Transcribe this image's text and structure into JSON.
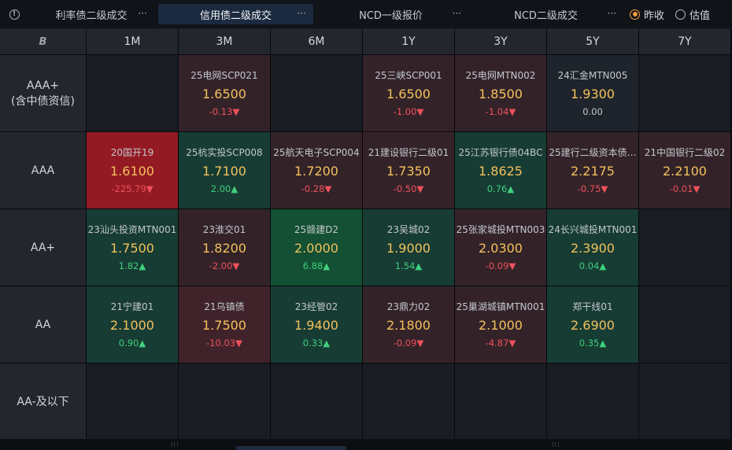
{
  "tabs": [
    {
      "label": "利率债二级成交",
      "more": "···"
    },
    {
      "label": "信用债二级成交",
      "more": "···",
      "active": true
    },
    {
      "label": "NCD一级报价",
      "more": "···"
    },
    {
      "label": "NCD二级成交",
      "more": "···"
    }
  ],
  "radios": [
    {
      "label": "昨收",
      "selected": true
    },
    {
      "label": "估值",
      "selected": false
    }
  ],
  "table": {
    "corner_icon": "B",
    "columns": [
      "1M",
      "3M",
      "6M",
      "1Y",
      "3Y",
      "5Y",
      "7Y"
    ],
    "rows": [
      {
        "label_line1": "AAA+",
        "label_line2": "(含中债资信)",
        "cells": [
          null,
          {
            "name": "25电网SCP021",
            "yield": "1.6500",
            "change": "-0.13",
            "arrow": "▼",
            "dir": "down",
            "tone": "down-light"
          },
          null,
          {
            "name": "25三峡SCP001",
            "yield": "1.6500",
            "change": "-1.00",
            "arrow": "▼",
            "dir": "down",
            "tone": "down-light"
          },
          {
            "name": "25电网MTN002",
            "yield": "1.8500",
            "change": "-1.04",
            "arrow": "▼",
            "dir": "down",
            "tone": "down-light"
          },
          {
            "name": "24汇金MTN005",
            "yield": "1.9300",
            "change": "0.00",
            "arrow": "",
            "dir": "flat",
            "tone": "neutral"
          },
          null
        ]
      },
      {
        "label_line1": "AAA",
        "label_line2": "",
        "cells": [
          {
            "name": "20国开19",
            "yield": "1.6100",
            "change": "-225.79",
            "arrow": "▼",
            "dir": "down",
            "tone": "down-strong"
          },
          {
            "name": "25杭实投SCP008",
            "yield": "1.7100",
            "change": "2.00",
            "arrow": "▲",
            "dir": "up",
            "tone": "up-light"
          },
          {
            "name": "25航天电子SCP004",
            "yield": "1.7200",
            "change": "-0.28",
            "arrow": "▼",
            "dir": "down",
            "tone": "down-light"
          },
          {
            "name": "21建设银行二级01",
            "yield": "1.7350",
            "change": "-0.50",
            "arrow": "▼",
            "dir": "down",
            "tone": "down-light"
          },
          {
            "name": "25江苏银行债04BC",
            "yield": "1.8625",
            "change": "0.76",
            "arrow": "▲",
            "dir": "up",
            "tone": "up-light"
          },
          {
            "name": "25建行二级资本债…",
            "yield": "2.2175",
            "change": "-0.75",
            "arrow": "▼",
            "dir": "down",
            "tone": "down-light"
          },
          {
            "name": "21中国银行二级02",
            "yield": "2.2100",
            "change": "-0.01",
            "arrow": "▼",
            "dir": "down",
            "tone": "down-light"
          }
        ]
      },
      {
        "label_line1": "AA+",
        "label_line2": "",
        "cells": [
          {
            "name": "23汕头投资MTN001",
            "yield": "1.7500",
            "change": "1.82",
            "arrow": "▲",
            "dir": "up",
            "tone": "up-light"
          },
          {
            "name": "23淮交01",
            "yield": "1.8200",
            "change": "-2.00",
            "arrow": "▼",
            "dir": "down",
            "tone": "down-light"
          },
          {
            "name": "25赣建D2",
            "yield": "2.0000",
            "change": "6.88",
            "arrow": "▲",
            "dir": "up",
            "tone": "up-strong"
          },
          {
            "name": "23吴城02",
            "yield": "1.9000",
            "change": "1.54",
            "arrow": "▲",
            "dir": "up",
            "tone": "up-light"
          },
          {
            "name": "25张家城投MTN003",
            "yield": "2.0300",
            "change": "-0.09",
            "arrow": "▼",
            "dir": "down",
            "tone": "down-light"
          },
          {
            "name": "24长兴城投MTN001",
            "yield": "2.3900",
            "change": "0.04",
            "arrow": "▲",
            "dir": "up",
            "tone": "up-light"
          },
          null
        ]
      },
      {
        "label_line1": "AA",
        "label_line2": "",
        "cells": [
          {
            "name": "21宁建01",
            "yield": "2.1000",
            "change": "0.90",
            "arrow": "▲",
            "dir": "up",
            "tone": "up-light"
          },
          {
            "name": "21乌镇债",
            "yield": "1.7500",
            "change": "-10.03",
            "arrow": "▼",
            "dir": "down",
            "tone": "down-mid"
          },
          {
            "name": "23经管02",
            "yield": "1.9400",
            "change": "0.33",
            "arrow": "▲",
            "dir": "up",
            "tone": "up-light"
          },
          {
            "name": "23鼎力02",
            "yield": "2.1800",
            "change": "-0.09",
            "arrow": "▼",
            "dir": "down",
            "tone": "down-light"
          },
          {
            "name": "25巢湖城镇MTN001",
            "yield": "2.1000",
            "change": "-4.87",
            "arrow": "▼",
            "dir": "down",
            "tone": "down-light"
          },
          {
            "name": "郑干线01",
            "yield": "2.6900",
            "change": "0.35",
            "arrow": "▲",
            "dir": "up",
            "tone": "up-light"
          },
          null
        ]
      },
      {
        "label_line1": "AA-及以下",
        "label_line2": "",
        "cells": [
          null,
          null,
          null,
          null,
          null,
          null,
          null
        ]
      }
    ]
  },
  "colors": {
    "accent": "#f29a3b",
    "up": "#3fd07c",
    "down": "#f0505c",
    "yield": "#f4c15c"
  }
}
